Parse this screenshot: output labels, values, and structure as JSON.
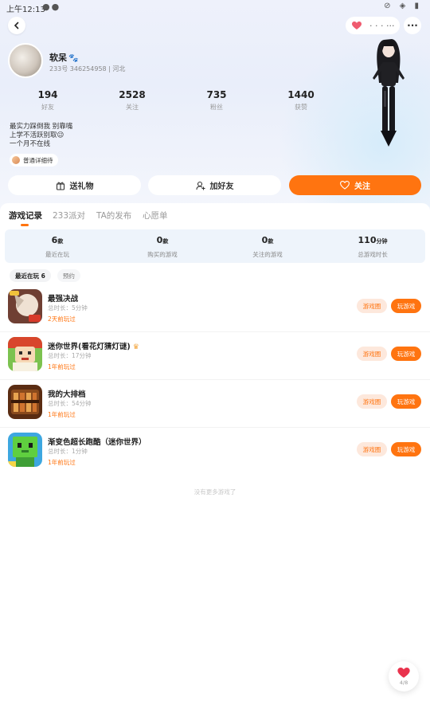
{
  "status_bar": {
    "time": "上午12:13"
  },
  "header": {
    "like_text": "· · · ···"
  },
  "profile": {
    "nickname": "软呆",
    "id_text": "233号 346254958 | 河北",
    "stats": [
      {
        "value": "194",
        "label": "好友"
      },
      {
        "value": "2528",
        "label": "关注"
      },
      {
        "value": "735",
        "label": "粉丝"
      },
      {
        "value": "1440",
        "label": "获赞"
      }
    ],
    "bio_lines": [
      "最实力踩倒我 别靠嘴",
      "上学不活跃别取😉",
      "一个月不在线"
    ],
    "ip_tag": "普通详细待"
  },
  "actions": {
    "gift": "送礼物",
    "add_friend": "加好友",
    "follow": "关注"
  },
  "tabs": [
    "游戏记录",
    "233派对",
    "TA的发布",
    "心愿单"
  ],
  "summary": [
    {
      "value": "6",
      "unit": "款",
      "label": "最近在玩"
    },
    {
      "value": "0",
      "unit": "款",
      "label": "购买的游戏"
    },
    {
      "value": "0",
      "unit": "款",
      "label": "关注的游戏"
    },
    {
      "value": "110",
      "unit": "分钟",
      "label": "总游戏时长"
    }
  ],
  "filters": {
    "recent": "最近在玩 6",
    "reserve": "预约"
  },
  "games": [
    {
      "title": "最强决战",
      "duration": "总时长：5分钟",
      "last_played": "2天前玩过",
      "circle_label": "游戏圈",
      "play_label": "玩游戏",
      "colors": [
        "#7a4a3a",
        "#e8d8c8"
      ]
    },
    {
      "title": "迷你世界(看花灯猜灯谜)",
      "duration": "总时长：17分钟",
      "last_played": "1年前玩过",
      "circle_label": "游戏圈",
      "play_label": "玩游戏",
      "colors": [
        "#d14b2f",
        "#6fb04a"
      ]
    },
    {
      "title": "我的大排档",
      "duration": "总时长：54分钟",
      "last_played": "1年前玩过",
      "circle_label": "游戏圈",
      "play_label": "玩游戏",
      "colors": [
        "#5a2c12",
        "#e0a45a"
      ]
    },
    {
      "title": "渐变色超长跑酷（迷你世界）",
      "duration": "总时长：1分钟",
      "last_played": "1年前玩过",
      "circle_label": "游戏圈",
      "play_label": "玩游戏",
      "colors": [
        "#4fbf3f",
        "#2f8fd8"
      ]
    }
  ],
  "end_text": "没有更多游戏了",
  "float_like": {
    "count": "4/8"
  },
  "colors": {
    "accent": "#ff7410"
  }
}
